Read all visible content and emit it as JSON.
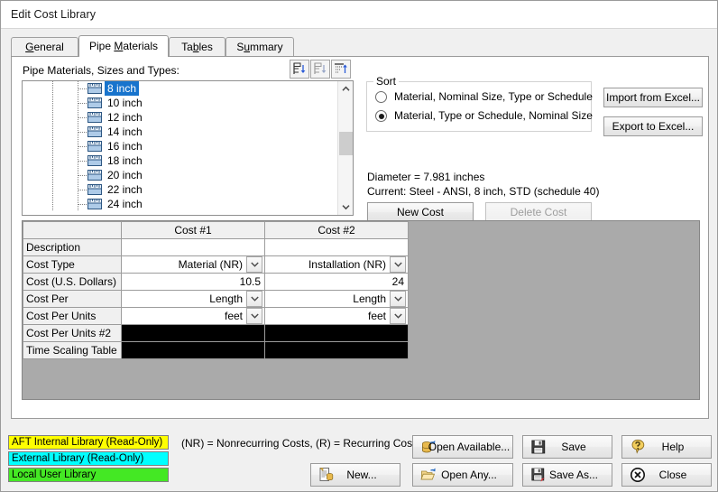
{
  "window": {
    "title": "Edit Cost Library"
  },
  "tabs": [
    {
      "name": "general",
      "label": "General",
      "accel": "G",
      "active": false
    },
    {
      "name": "pipe-materials",
      "label": "Pipe Materials",
      "accel": "M",
      "active": true
    },
    {
      "name": "tables",
      "label": "Tables",
      "accel": "b",
      "active": false
    },
    {
      "name": "summary",
      "label": "Summary",
      "accel": "u",
      "active": false
    }
  ],
  "tree_section": {
    "label": "Pipe Materials, Sizes and Types:",
    "toolbar": [
      {
        "name": "expand-all-icon",
        "title": "Expand All"
      },
      {
        "name": "collapse-all-icon",
        "title": "Collapse All"
      },
      {
        "name": "show-selected-icon",
        "title": "Show Selected"
      }
    ],
    "items": [
      {
        "label": "8 inch",
        "selected": true
      },
      {
        "label": "10 inch",
        "selected": false
      },
      {
        "label": "12 inch",
        "selected": false
      },
      {
        "label": "14 inch",
        "selected": false
      },
      {
        "label": "16 inch",
        "selected": false
      },
      {
        "label": "18 inch",
        "selected": false
      },
      {
        "label": "20 inch",
        "selected": false
      },
      {
        "label": "22 inch",
        "selected": false
      },
      {
        "label": "24 inch",
        "selected": false
      }
    ]
  },
  "sort": {
    "title": "Sort",
    "options": [
      {
        "label": "Material, Nominal Size, Type or Schedule",
        "checked": false
      },
      {
        "label": "Material, Type or Schedule, Nominal Size",
        "checked": true
      }
    ]
  },
  "excel": {
    "import_label": "Import from Excel...",
    "export_label": "Export to Excel..."
  },
  "info": {
    "diameter": "Diameter = 7.981 inches",
    "current": "Current: Steel - ANSI, 8 inch, STD (schedule 40)",
    "new_cost_label": "New Cost",
    "delete_cost_label": "Delete Cost",
    "delete_cost_enabled": false
  },
  "cost_grid": {
    "columns": [
      "",
      "Cost #1",
      "Cost #2"
    ],
    "rows": [
      {
        "header": "Description",
        "kind": "text",
        "values": [
          "",
          ""
        ]
      },
      {
        "header": "Cost Type",
        "kind": "combo",
        "values": [
          "Material (NR)",
          "Installation (NR)"
        ]
      },
      {
        "header": "Cost (U.S. Dollars)",
        "kind": "text",
        "values": [
          "10.5",
          "24"
        ]
      },
      {
        "header": "Cost Per",
        "kind": "combo",
        "values": [
          "Length",
          "Length"
        ]
      },
      {
        "header": "Cost Per Units",
        "kind": "combo",
        "values": [
          "feet",
          "feet"
        ]
      },
      {
        "header": "Cost Per Units #2",
        "kind": "black",
        "values": [
          "",
          ""
        ]
      },
      {
        "header": "Time Scaling Table",
        "kind": "black",
        "values": [
          "",
          ""
        ]
      }
    ]
  },
  "legend": {
    "items": [
      {
        "label": "AFT Internal Library (Read-Only)",
        "color": "#ffff00"
      },
      {
        "label": "External Library (Read-Only)",
        "color": "#00ffff"
      },
      {
        "label": "Local User Library",
        "color": "#44e824"
      }
    ],
    "note": "(NR) = Nonrecurring Costs, (R) = Recurring Costs"
  },
  "actions": [
    {
      "name": "new-button",
      "label": "New...",
      "icon": "new-document-icon"
    },
    {
      "name": "open-available-button",
      "label": "Open Available...",
      "icon": "database-open-icon"
    },
    {
      "name": "open-any-button",
      "label": "Open Any...",
      "icon": "folder-open-icon"
    },
    {
      "name": "save-button",
      "label": "Save",
      "icon": "floppy-disk-icon"
    },
    {
      "name": "save-as-button",
      "label": "Save As...",
      "icon": "floppy-disk-pencil-icon"
    },
    {
      "name": "help-button",
      "label": "Help",
      "icon": "question-balloon-icon"
    },
    {
      "name": "close-button",
      "label": "Close",
      "icon": "close-circle-icon"
    }
  ]
}
